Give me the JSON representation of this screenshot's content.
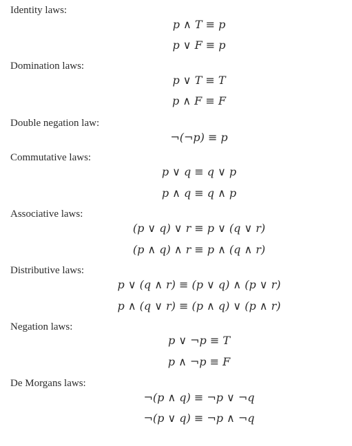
{
  "sections": [
    {
      "heading": "Identity laws:",
      "formulas": [
        "p ∧ T ≡ p",
        "p ∨ F ≡ p"
      ]
    },
    {
      "heading": "Domination laws:",
      "formulas": [
        "p ∨ T ≡ T",
        "p ∧ F ≡ F"
      ]
    },
    {
      "heading": "Double negation law:",
      "formulas": [
        "¬(¬p) ≡ p"
      ]
    },
    {
      "heading": "Commutative laws:",
      "formulas": [
        "p ∨ q ≡ q ∨ p",
        "p ∧ q ≡ q ∧ p"
      ]
    },
    {
      "heading": "Associative laws:",
      "formulas": [
        "(p ∨ q) ∨ r ≡ p ∨ (q ∨ r)",
        "(p ∧ q) ∧ r ≡ p ∧ (q ∧ r)"
      ]
    },
    {
      "heading": "Distributive laws:",
      "formulas": [
        "p ∨ (q ∧ r) ≡ (p ∨ q) ∧ (p ∨ r)",
        "p ∧ (q ∨ r) ≡ (p ∧ q) ∨ (p ∧ r)"
      ]
    },
    {
      "heading": "Negation laws:",
      "formulas": [
        "p ∨ ¬p ≡ T",
        "p ∧ ¬p ≡ F"
      ]
    },
    {
      "heading": "De Morgans laws:",
      "formulas": [
        "¬(p ∧ q) ≡ ¬p ∨ ¬q",
        "¬(p ∨ q) ≡ ¬p ∧ ¬q"
      ]
    }
  ]
}
